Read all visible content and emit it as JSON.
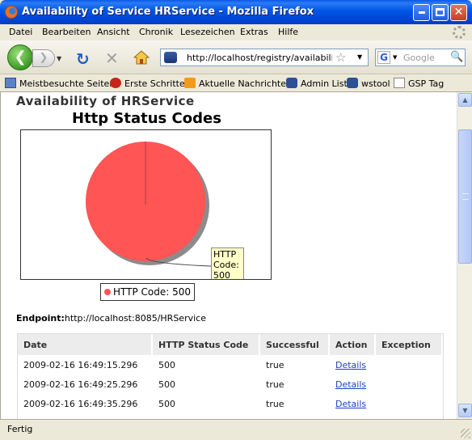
{
  "window": {
    "title": "Availability of Service HRService - Mozilla Firefox"
  },
  "menu": [
    "Datei",
    "Bearbeiten",
    "Ansicht",
    "Chronik",
    "Lesezeichen",
    "Extras",
    "Hilfe"
  ],
  "url": "http://localhost/registry/availability/sl",
  "search": {
    "placeholder": "Google"
  },
  "bookmarks": [
    "Meistbesuchte Seiten",
    "Erste Schritte",
    "Aktuelle Nachrichten",
    "Admin List",
    "wstool",
    "GSP Tag"
  ],
  "page": {
    "title": "Availability of HRService",
    "endpoint_label": "Endpoint:",
    "endpoint": "http://localhost:8085/HRService"
  },
  "chart_data": {
    "type": "pie",
    "title": "Http Status Codes",
    "slices": [
      {
        "label": "HTTP Code: 500",
        "value": 100,
        "color": "#ff5555"
      }
    ],
    "callout": "HTTP Code: 500",
    "legend": [
      "HTTP Code: 500"
    ]
  },
  "table": {
    "headers": [
      "Date",
      "HTTP Status Code",
      "Successful",
      "Action",
      "Exception"
    ],
    "rows": [
      [
        "2009-02-16 16:49:15.296",
        "500",
        "true",
        "Details",
        ""
      ],
      [
        "2009-02-16 16:49:25.296",
        "500",
        "true",
        "Details",
        ""
      ],
      [
        "2009-02-16 16:49:35.296",
        "500",
        "true",
        "Details",
        ""
      ]
    ]
  },
  "status": "Fertig"
}
